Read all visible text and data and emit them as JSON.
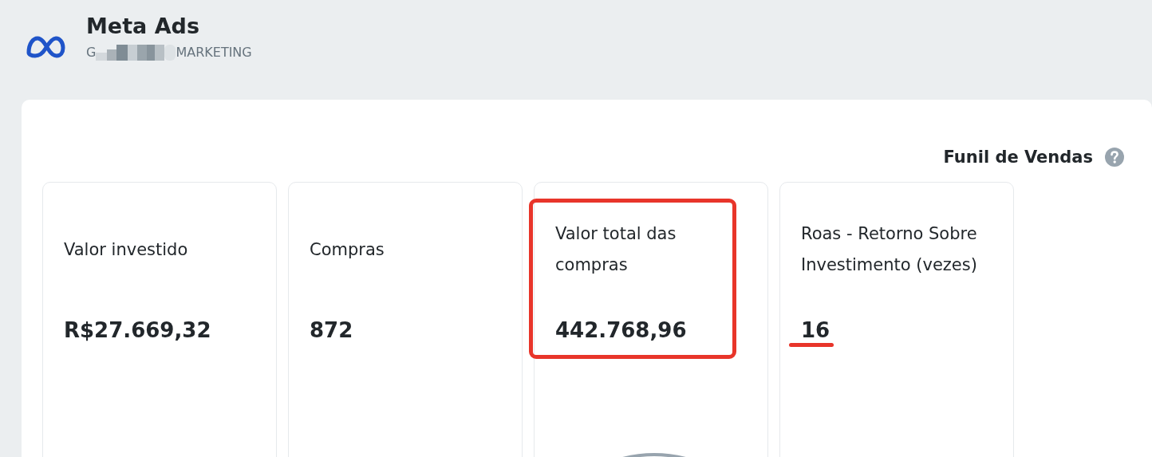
{
  "header": {
    "title": "Meta Ads",
    "subtitle_start": "G",
    "subtitle_end": "MARKETING"
  },
  "panel": {
    "title": "Funil de Vendas"
  },
  "cards": [
    {
      "label": "Valor investido",
      "value": "R$27.669,32",
      "highlighted": false,
      "underlined": false,
      "gauge": false
    },
    {
      "label": "Compras",
      "value": "872",
      "highlighted": false,
      "underlined": false,
      "gauge": false
    },
    {
      "label": "Valor total das compras",
      "value": "442.768,96",
      "highlighted": true,
      "underlined": false,
      "gauge": true
    },
    {
      "label": "Roas - Retorno Sobre Investimento (vezes)",
      "value": "16",
      "highlighted": false,
      "underlined": true,
      "gauge": false
    }
  ]
}
